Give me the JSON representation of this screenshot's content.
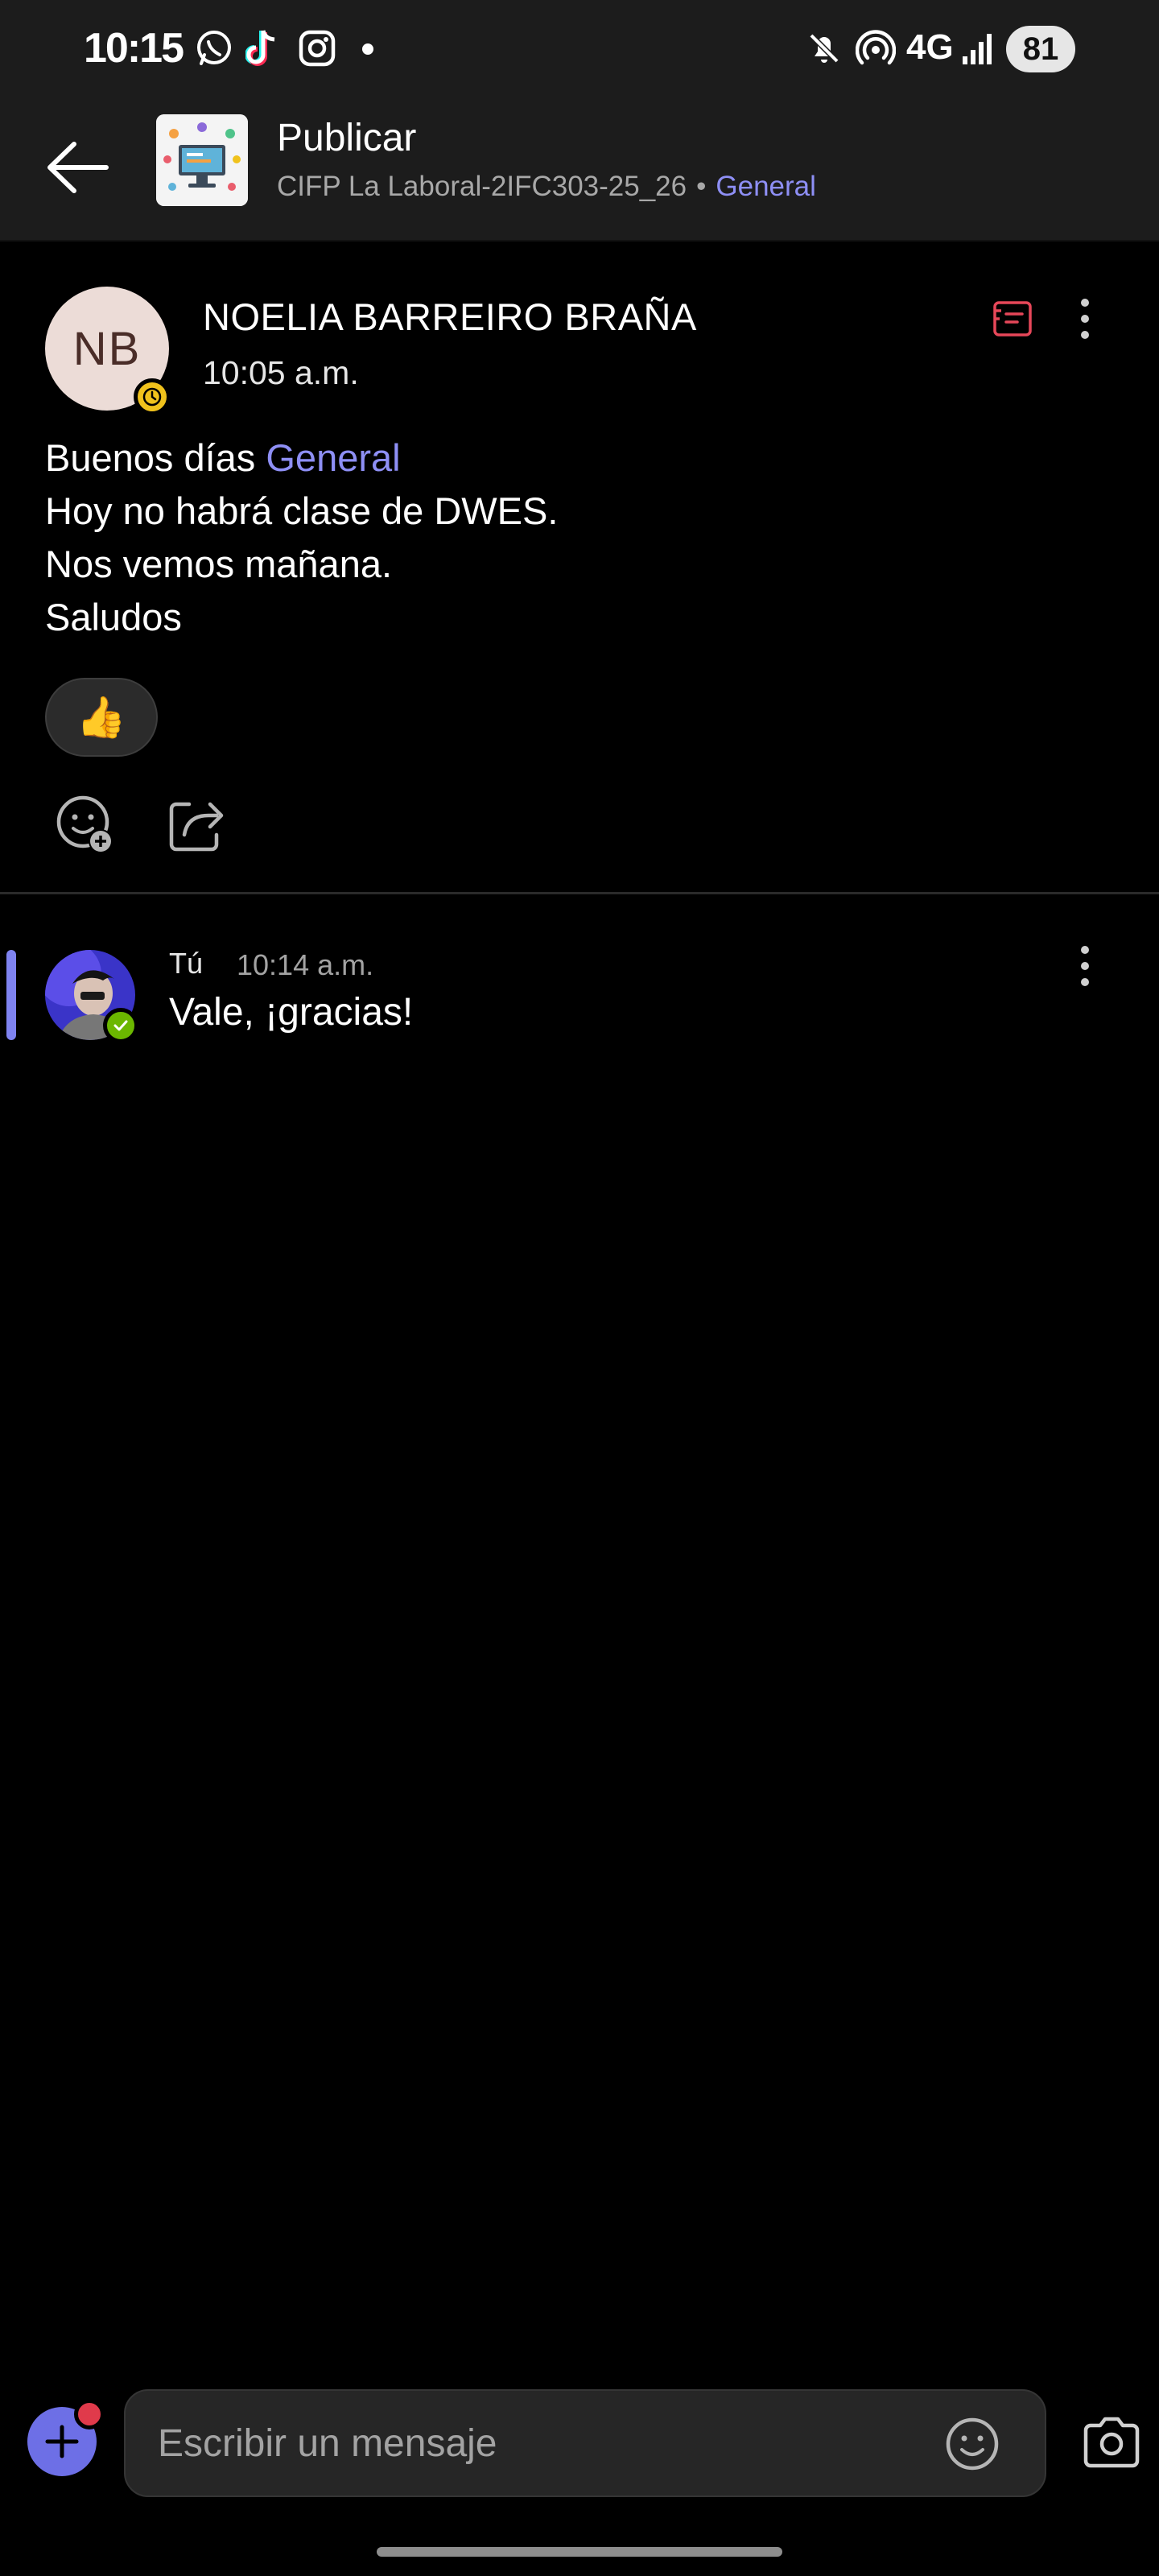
{
  "status_bar": {
    "time": "10:15",
    "network": "4G",
    "battery": "81",
    "left_icons": [
      "whatsapp-icon",
      "tiktok-icon",
      "instagram-icon"
    ],
    "right_icons": [
      "mute-icon",
      "hotspot-icon",
      "signal-icon"
    ]
  },
  "header": {
    "title": "Publicar",
    "team": "CIFP La Laboral-2IFC303-25_26",
    "separator": "•",
    "channel": "General",
    "accent_color": "#8e8ff5"
  },
  "post": {
    "avatar_initials": "NB",
    "author": "NOELIA BARREIRO BRAÑA",
    "time": "10:05 a.m.",
    "presence": "away",
    "body_greeting": "Buenos días",
    "mention": "General",
    "body_lines": [
      "Hoy no habrá clase de DWES.",
      "Nos vemos mañana.",
      "Saludos"
    ],
    "reaction": "👍"
  },
  "reply": {
    "author": "Tú",
    "time": "10:14 a.m.",
    "text": "Vale, ¡gracias!",
    "presence": "available"
  },
  "composer": {
    "placeholder": "Escribir un mensaje"
  }
}
